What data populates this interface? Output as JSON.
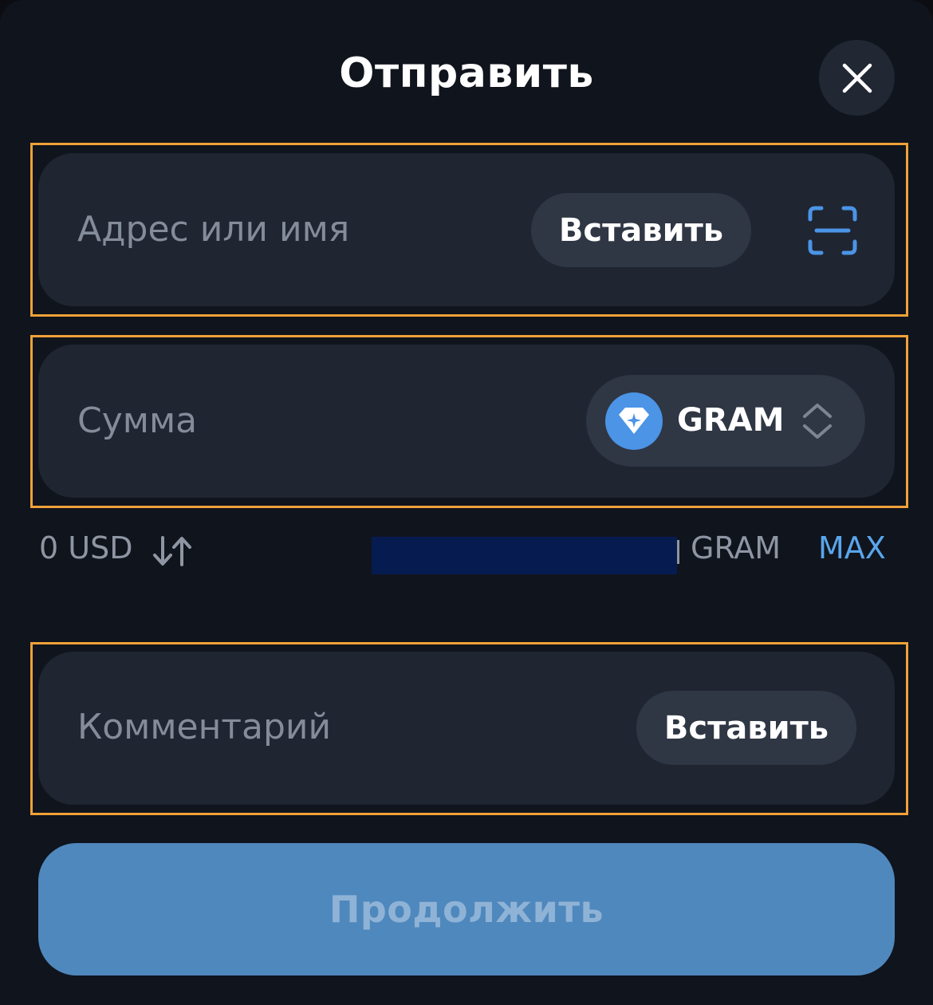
{
  "header": {
    "title": "Отправить",
    "close_icon": "close-icon"
  },
  "address_field": {
    "placeholder": "Адрес или имя",
    "paste_label": "Вставить",
    "scan_icon": "qr-scan-icon"
  },
  "amount_field": {
    "placeholder": "Сумма",
    "token": {
      "symbol": "GRAM",
      "logo_icon": "gram-diamond-icon",
      "selector_icon": "chevron-up-down-icon"
    }
  },
  "balance_row": {
    "fiat_amount": "0 USD",
    "swap_icon": "swap-arrows-icon",
    "balance_unit": "GRAM",
    "max_label": "MAX"
  },
  "comment_field": {
    "placeholder": "Комментарий",
    "paste_label": "Вставить"
  },
  "continue_button": {
    "label": "Продолжить"
  },
  "colors": {
    "background": "#10141d",
    "card": "#1f2531",
    "pill": "#2f3644",
    "accent": "#59a6ec",
    "primary_button": "#4f88bd",
    "highlight_outline": "#f0a138"
  }
}
